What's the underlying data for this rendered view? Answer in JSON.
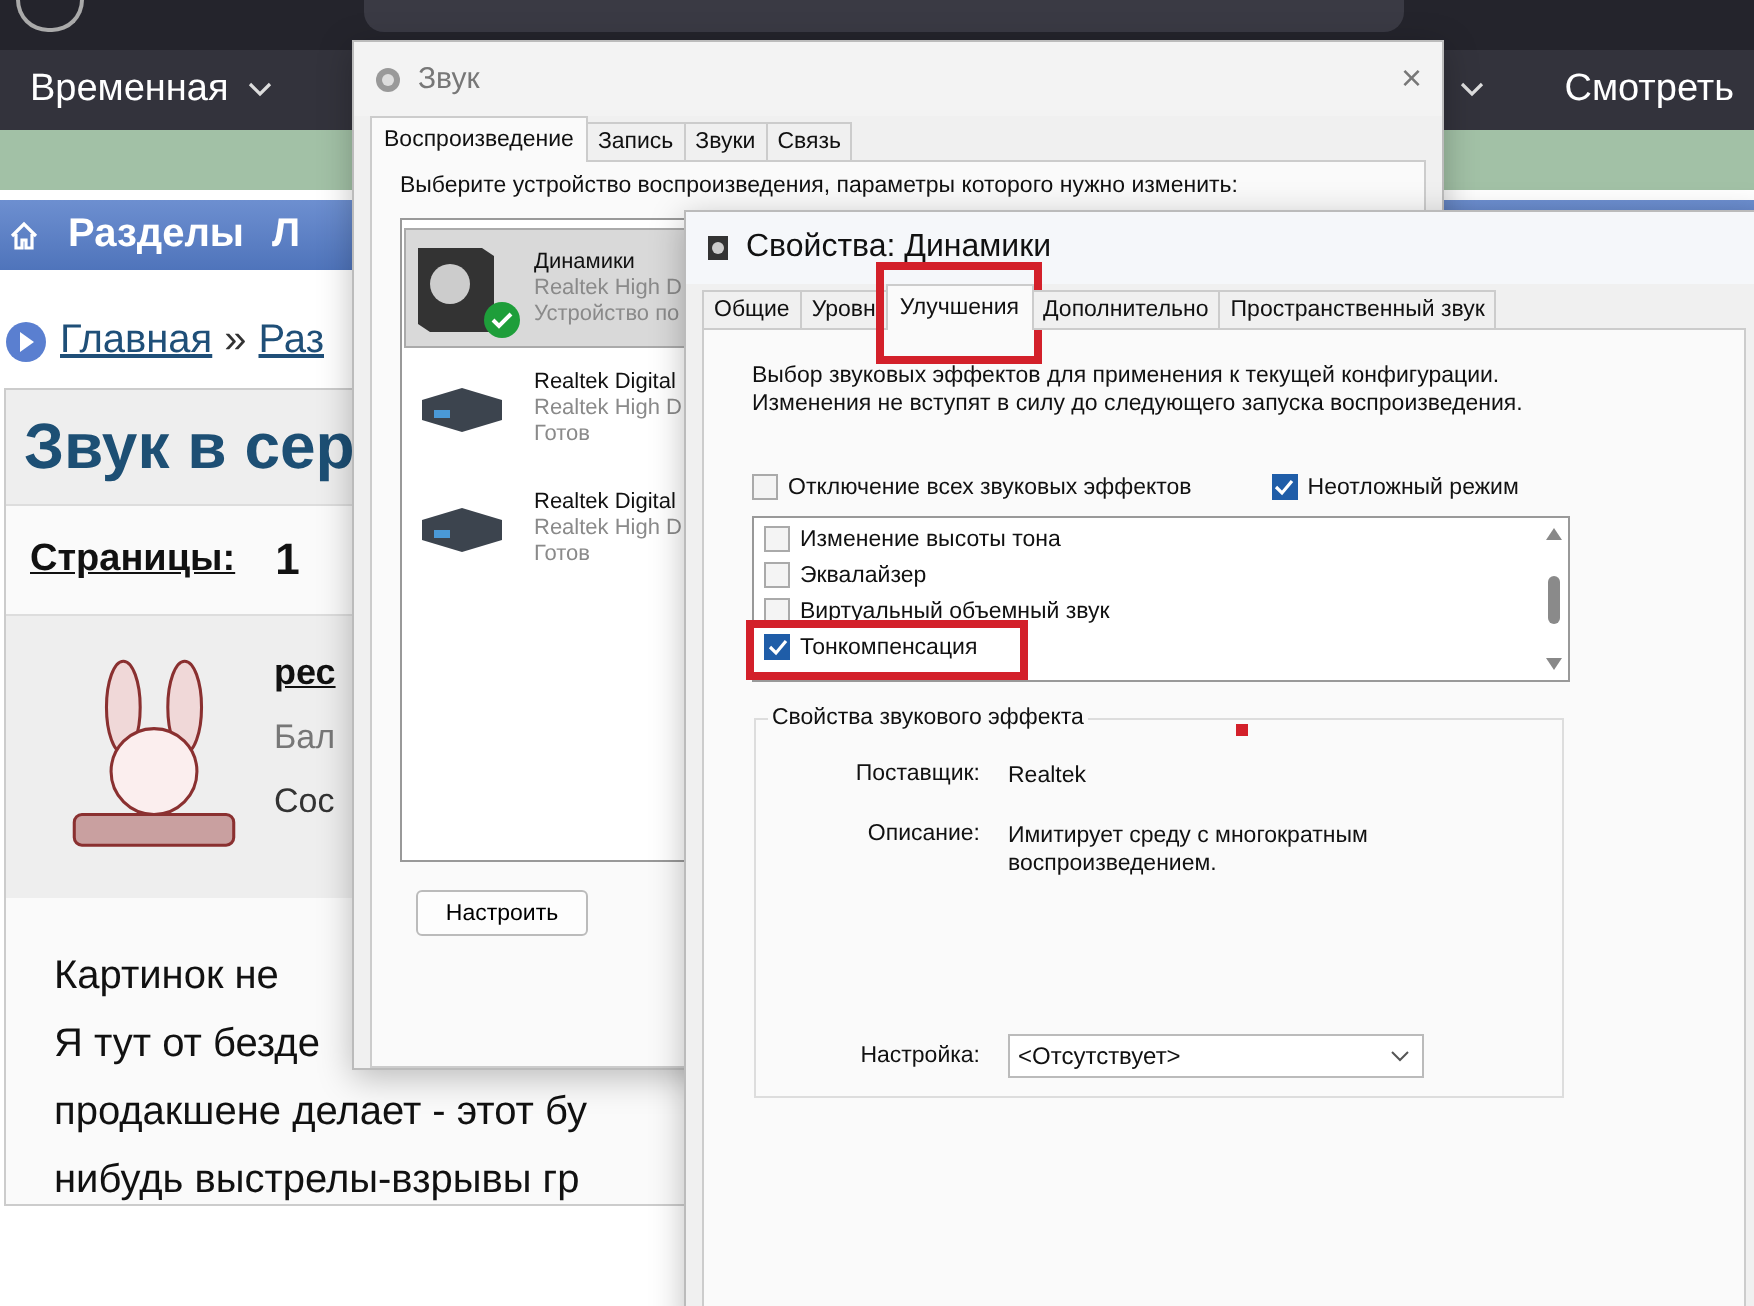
{
  "browser": {
    "nav_left": "Временная",
    "nav_right": "Смотреть"
  },
  "site": {
    "section_bar": "Разделы",
    "section_bar_next": "Л",
    "breadcrumb": [
      "Главная",
      "Раз"
    ],
    "breadcrumb_separator": "»",
    "title": "Звук в сер",
    "pages_label": "Страницы:",
    "pages": [
      {
        "label": "1",
        "selected": true
      }
    ],
    "author": "рес",
    "author_line_2": "Бал",
    "author_line_3": "Сос",
    "body_lines": [
      "Картинок не",
      "Я тут от безде",
      "продакшене делает - этот бу",
      "нибудь выстрелы-взрывы гр"
    ]
  },
  "sound_dialog": {
    "title": "Звук",
    "close_button": "×",
    "tabs": [
      {
        "label": "Воспроизведение",
        "selected": true
      },
      {
        "label": "Запись",
        "selected": false
      },
      {
        "label": "Звуки",
        "selected": false
      },
      {
        "label": "Связь",
        "selected": false
      }
    ],
    "instruction": "Выберите устройство воспроизведения, параметры которого нужно изменить:",
    "devices": [
      {
        "kind": "speaker",
        "name": "Динамики",
        "driver": "Realtek High D",
        "status": "Устройство по",
        "selected": true,
        "default": true
      },
      {
        "kind": "digital",
        "name": "Realtek Digital",
        "driver": "Realtek High D",
        "status": "Готов",
        "selected": false,
        "default": false
      },
      {
        "kind": "digital",
        "name": "Realtek Digital",
        "driver": "Realtek High D",
        "status": "Готов",
        "selected": false,
        "default": false
      }
    ],
    "configure_button": "Настроить"
  },
  "properties_dialog": {
    "title": "Свойства: Динамики",
    "tabs": [
      {
        "label": "Общие",
        "selected": false
      },
      {
        "label": "Уровн",
        "selected": false
      },
      {
        "label": "Улучшения",
        "selected": true,
        "highlighted": true
      },
      {
        "label": "Дополнительно",
        "selected": false
      },
      {
        "label": "Пространственный звук",
        "selected": false
      }
    ],
    "description": "Выбор звуковых эффектов для применения к текущей конфигурации. Изменения не вступят в силу до следующего запуска воспроизведения.",
    "options": [
      {
        "label": "Отключение всех звуковых эффектов",
        "checked": false
      },
      {
        "label": "Неотложный режим",
        "checked": true
      }
    ],
    "effects": [
      {
        "label": "Изменение высоты тона",
        "checked": false
      },
      {
        "label": "Эквалайзер",
        "checked": false
      },
      {
        "label": "Виртуальный объемный звук",
        "checked": false
      },
      {
        "label": "Тонкомпенсация",
        "checked": true,
        "highlighted": true
      }
    ],
    "group_title": "Свойства звукового эффекта",
    "provider_label": "Поставщик:",
    "provider": "Realtek",
    "effect_description_label": "Описание:",
    "effect_description": "Имитирует среду с многократным воспроизведением.",
    "setting_label": "Настройка:",
    "setting_value": "<Отсутствует>"
  }
}
